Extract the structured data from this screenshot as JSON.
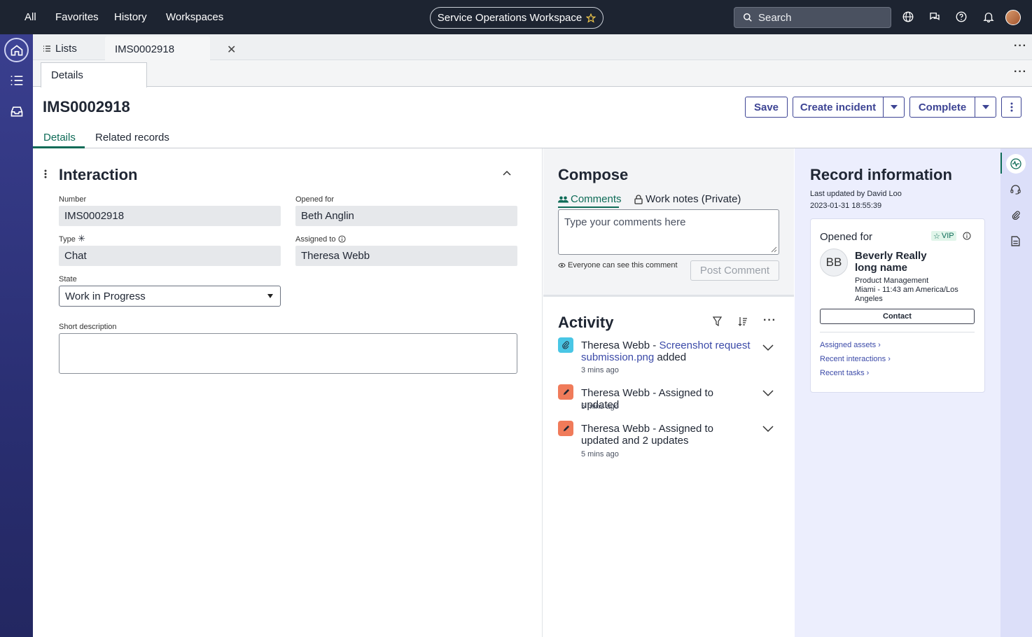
{
  "topbar": {
    "nav": [
      "All",
      "Favorites",
      "History",
      "Workspaces"
    ],
    "workspace": "Service Operations Workspace",
    "search_placeholder": "Search"
  },
  "tabs": {
    "lists_label": "Lists",
    "record_tab": "IMS0002918",
    "detail_subtab": "Details"
  },
  "header": {
    "title": "IMS0002918",
    "save": "Save",
    "create_incident": "Create incident",
    "complete": "Complete"
  },
  "record_tabs": [
    "Details",
    "Related records"
  ],
  "interaction": {
    "title": "Interaction",
    "number_label": "Number",
    "number_value": "IMS0002918",
    "opened_for_label": "Opened for",
    "opened_for_value": "Beth Anglin",
    "type_label": "Type",
    "type_value": "Chat",
    "assigned_to_label": "Assigned to",
    "assigned_to_value": "Theresa Webb",
    "state_label": "State",
    "state_value": "Work in Progress",
    "short_desc_label": "Short description",
    "short_desc_value": ""
  },
  "compose": {
    "title": "Compose",
    "tab_comments": "Comments",
    "tab_worknotes": "Work notes (Private)",
    "placeholder": "Type your comments here",
    "visibility_note": "Everyone can see this comment",
    "post_button": "Post Comment"
  },
  "activity": {
    "title": "Activity",
    "items": [
      {
        "author": "Theresa Webb",
        "sep": " - ",
        "link": "Screenshot request submission.png",
        "tail": " added",
        "time": "3 mins ago",
        "kind": "attachment",
        "color": "#49c6e5"
      },
      {
        "author": "Theresa Webb",
        "sep": " - ",
        "text": "Assigned to updated",
        "time": "5 mins ago",
        "kind": "edit",
        "color": "#f07b5a"
      },
      {
        "author": "Theresa Webb",
        "sep": " - ",
        "text": "Assigned to updated and 2 updates",
        "time": "5 mins ago",
        "kind": "edit",
        "color": "#f07b5a"
      }
    ]
  },
  "record_info": {
    "title": "Record information",
    "last_updated": "Last updated by David Loo",
    "timestamp": "2023-01-31 18:55:39",
    "card_title": "Opened for",
    "vip": "VIP",
    "initials": "BB",
    "name": "Beverly Really long name",
    "dept": "Product Management",
    "location": "Miami - 11:43 am America/Los Angeles",
    "contact": "Contact",
    "links": [
      "Assigned assets",
      "Recent interactions",
      "Recent tasks"
    ]
  },
  "colors": {
    "accent_green": "#0e6b57",
    "brand_indigo": "#3d4494",
    "topbar": "#1d2431"
  }
}
